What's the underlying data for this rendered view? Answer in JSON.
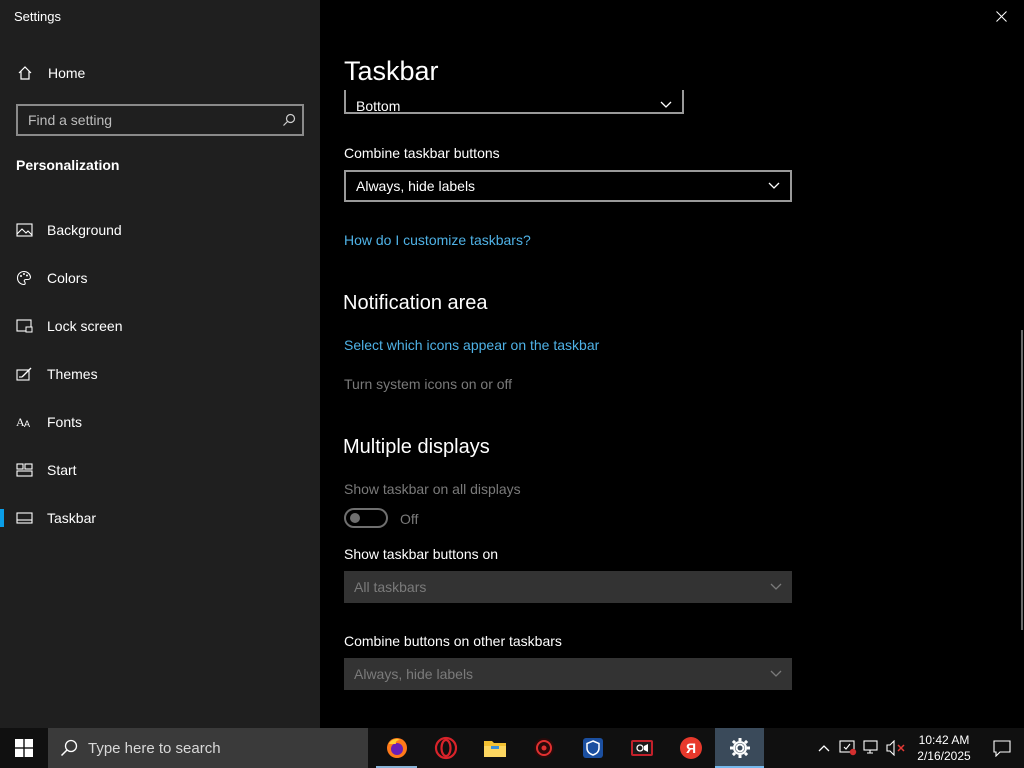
{
  "app": {
    "title": "Settings"
  },
  "sidebar": {
    "home_label": "Home",
    "search_placeholder": "Find a setting",
    "section": "Personalization",
    "items": [
      {
        "label": "Background",
        "icon": "image-icon"
      },
      {
        "label": "Colors",
        "icon": "palette-icon"
      },
      {
        "label": "Lock screen",
        "icon": "lock-screen-icon"
      },
      {
        "label": "Themes",
        "icon": "themes-icon"
      },
      {
        "label": "Fonts",
        "icon": "fonts-icon"
      },
      {
        "label": "Start",
        "icon": "start-icon"
      },
      {
        "label": "Taskbar",
        "icon": "taskbar-icon",
        "active": true
      }
    ]
  },
  "main": {
    "title": "Taskbar",
    "position_value": "Bottom",
    "combine_label": "Combine taskbar buttons",
    "combine_value": "Always, hide labels",
    "customize_link": "How do I customize taskbars?",
    "notification_heading": "Notification area",
    "select_icons_link": "Select which icons appear on the taskbar",
    "system_icons_text": "Turn system icons on or off",
    "multiple_heading": "Multiple displays",
    "show_all_label": "Show taskbar on all displays",
    "toggle_state": "Off",
    "show_buttons_label": "Show taskbar buttons on",
    "show_buttons_value": "All taskbars",
    "combine_other_label": "Combine buttons on other taskbars",
    "combine_other_value": "Always, hide labels"
  },
  "taskbar": {
    "search_text": "Type here to search",
    "time": "10:42 AM",
    "date": "2/16/2025",
    "apps": [
      "firefox-icon",
      "opera-icon",
      "file-explorer-icon",
      "davinci-icon",
      "security-icon",
      "camera-app-icon",
      "yandex-icon",
      "settings-gear-icon"
    ]
  },
  "colors": {
    "accent": "#0a9ee8",
    "link": "#4fb2e6",
    "sidebar": "#1f1f1f"
  }
}
